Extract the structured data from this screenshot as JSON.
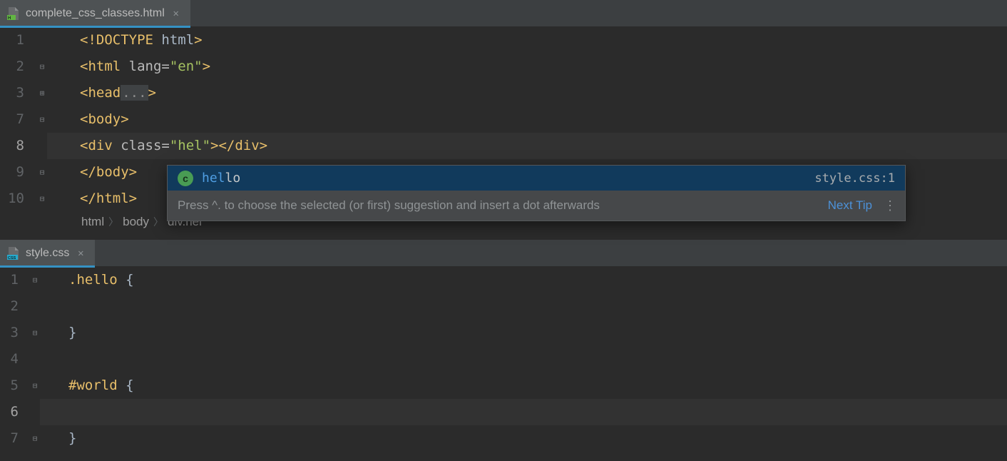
{
  "tabs": {
    "primary": {
      "label": "complete_css_classes.html"
    },
    "secondary": {
      "label": "style.css"
    }
  },
  "htmlEditor": {
    "lineNumbers": [
      "1",
      "2",
      "3",
      "7",
      "8",
      "9",
      "10"
    ],
    "lines": {
      "doctype_open": "<!",
      "doctype_kw": "DOCTYPE ",
      "doctype_txt": "html",
      "doctype_close": ">",
      "html_open": "<html ",
      "lang_attr": "lang=",
      "lang_val": "\"en\"",
      "tag_close": ">",
      "head_open": "<head",
      "head_dots": "...",
      "body_open": "<body>",
      "div_open": "<div ",
      "class_attr": "class=",
      "class_val": "\"hel\"",
      "div_close": "></div>",
      "body_close": "</body>",
      "html_close": "</html>"
    }
  },
  "breadcrumb": {
    "a": "html",
    "b": "body",
    "c": "div.hel"
  },
  "completion": {
    "badge": "c",
    "match": "hel",
    "rest": "lo",
    "location": "style.css:1",
    "hint": "Press ^. to choose the selected (or first) suggestion and insert a dot afterwards",
    "next": "Next Tip"
  },
  "cssEditor": {
    "lineNumbers": [
      "1",
      "2",
      "3",
      "4",
      "5",
      "6",
      "7"
    ],
    "sel1": ".hello",
    "open": " {",
    "close": "}",
    "sel2": "#world"
  }
}
